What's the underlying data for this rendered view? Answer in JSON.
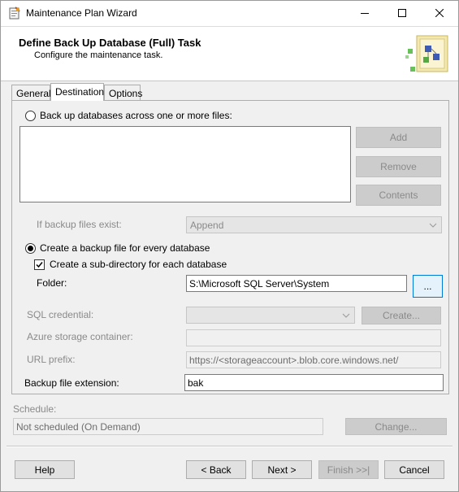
{
  "window": {
    "title": "Maintenance Plan Wizard",
    "minimize_icon": "minimize-icon",
    "maximize_icon": "maximize-icon",
    "close_icon": "close-icon"
  },
  "header": {
    "title": "Define Back Up Database (Full) Task",
    "subtitle": "Configure the maintenance task."
  },
  "tabs": [
    {
      "label": "General",
      "active": false
    },
    {
      "label": "Destination",
      "active": true
    },
    {
      "label": "Options",
      "active": false
    }
  ],
  "destination": {
    "backup_across_files_label": "Back up databases across one or more files:",
    "backup_across_files_selected": false,
    "add_label": "Add",
    "remove_label": "Remove",
    "contents_label": "Contents",
    "if_exists_label": "If backup files exist:",
    "if_exists_value": "Append",
    "per_database_label": "Create a backup file for every database",
    "per_database_selected": true,
    "subdirectory_label": "Create a sub-directory for each database",
    "subdirectory_checked": true,
    "folder_label": "Folder:",
    "folder_value": "S:\\Microsoft SQL Server\\System",
    "browse_label": "...",
    "sql_credential_label": "SQL credential:",
    "sql_credential_value": "",
    "create_label": "Create...",
    "azure_container_label": "Azure storage container:",
    "azure_container_value": "",
    "url_prefix_label": "URL prefix:",
    "url_prefix_value": "https://<storageaccount>.blob.core.windows.net/",
    "extension_label": "Backup file extension:",
    "extension_value": "bak"
  },
  "schedule": {
    "label": "Schedule:",
    "value": "Not scheduled (On Demand)",
    "change_label": "Change..."
  },
  "footer": {
    "help_label": "Help",
    "back_label": "< Back",
    "next_label": "Next >",
    "finish_label": "Finish >>|",
    "cancel_label": "Cancel"
  },
  "colors": {
    "focus_border": "#0078d7",
    "disabled_text": "#8a8a8a",
    "window_bg": "#f0f0f0"
  }
}
